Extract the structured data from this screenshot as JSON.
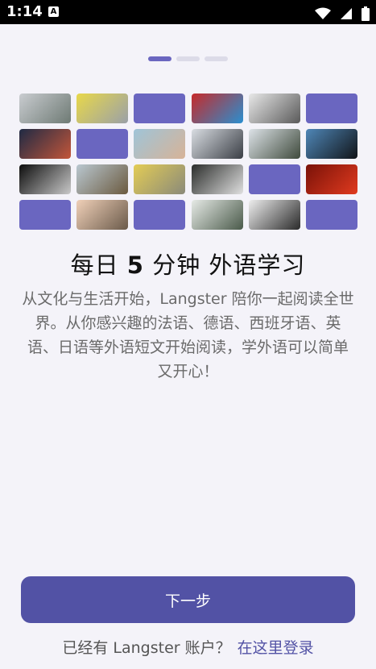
{
  "status_bar": {
    "time": "1:14",
    "notification_badge": "A",
    "icons": [
      "wifi-icon",
      "cellular-signal-icon",
      "battery-icon"
    ]
  },
  "pager": {
    "total_pages": 3,
    "current_page": 1
  },
  "colors": {
    "accent": "#5252a5",
    "placeholder_tile": "#6a66c0",
    "background": "#f4f3f9"
  },
  "image_grid": {
    "tiles": [
      {
        "kind": "photo",
        "theme": "misty-landscape",
        "c1": "#c9ccd0",
        "c2": "#6e7a74"
      },
      {
        "kind": "photo",
        "theme": "yellow-room",
        "c1": "#e8d84a",
        "c2": "#9aa0a8"
      },
      {
        "kind": "placeholder"
      },
      {
        "kind": "photo",
        "theme": "neon-portrait",
        "c1": "#c62a2a",
        "c2": "#2a8fd0"
      },
      {
        "kind": "photo",
        "theme": "building-facade",
        "c1": "#e8e8e8",
        "c2": "#5a5a5a"
      },
      {
        "kind": "placeholder"
      },
      {
        "kind": "photo",
        "theme": "night-sky",
        "c1": "#1f2a44",
        "c2": "#c3563a"
      },
      {
        "kind": "placeholder"
      },
      {
        "kind": "photo",
        "theme": "hand-sea",
        "c1": "#9fc4d8",
        "c2": "#d7b397"
      },
      {
        "kind": "photo",
        "theme": "skyscrapers",
        "c1": "#d9dde2",
        "c2": "#3a3e45"
      },
      {
        "kind": "photo",
        "theme": "forest-sky",
        "c1": "#dde3e8",
        "c2": "#3f4a3c"
      },
      {
        "kind": "photo",
        "theme": "plane-trees",
        "c1": "#4f87b8",
        "c2": "#111418"
      },
      {
        "kind": "photo",
        "theme": "tunnel-lights",
        "c1": "#0d0d0d",
        "c2": "#c9c9c9"
      },
      {
        "kind": "photo",
        "theme": "seaside-town",
        "c1": "#b9c7d0",
        "c2": "#6b5a3f"
      },
      {
        "kind": "photo",
        "theme": "yellow-wall",
        "c1": "#e3cc55",
        "c2": "#8a8a7a"
      },
      {
        "kind": "photo",
        "theme": "waterfall",
        "c1": "#2b2d2b",
        "c2": "#e0e0e0"
      },
      {
        "kind": "placeholder"
      },
      {
        "kind": "photo",
        "theme": "red-shadow",
        "c1": "#7a1208",
        "c2": "#e03a1f"
      },
      {
        "kind": "placeholder"
      },
      {
        "kind": "photo",
        "theme": "beach-person",
        "c1": "#f0d0b8",
        "c2": "#6a5a4a"
      },
      {
        "kind": "placeholder"
      },
      {
        "kind": "photo",
        "theme": "mountain-mist",
        "c1": "#e6eae6",
        "c2": "#4a5a4a"
      },
      {
        "kind": "photo",
        "theme": "person-snow",
        "c1": "#eeeeee",
        "c2": "#2a2a2a"
      },
      {
        "kind": "placeholder"
      }
    ]
  },
  "content": {
    "title_prefix": "每日",
    "title_number": "5",
    "title_suffix": "分钟 外语学习",
    "description": "从文化与生活开始，Langster 陪你一起阅读全世界。从你感兴趣的法语、德语、西班牙语、英语、日语等外语短文开始阅读，学外语可以简单又开心！"
  },
  "actions": {
    "next_label": "下一步",
    "login_prompt": "已经有 Langster 账户？",
    "login_link": "在这里登录"
  }
}
